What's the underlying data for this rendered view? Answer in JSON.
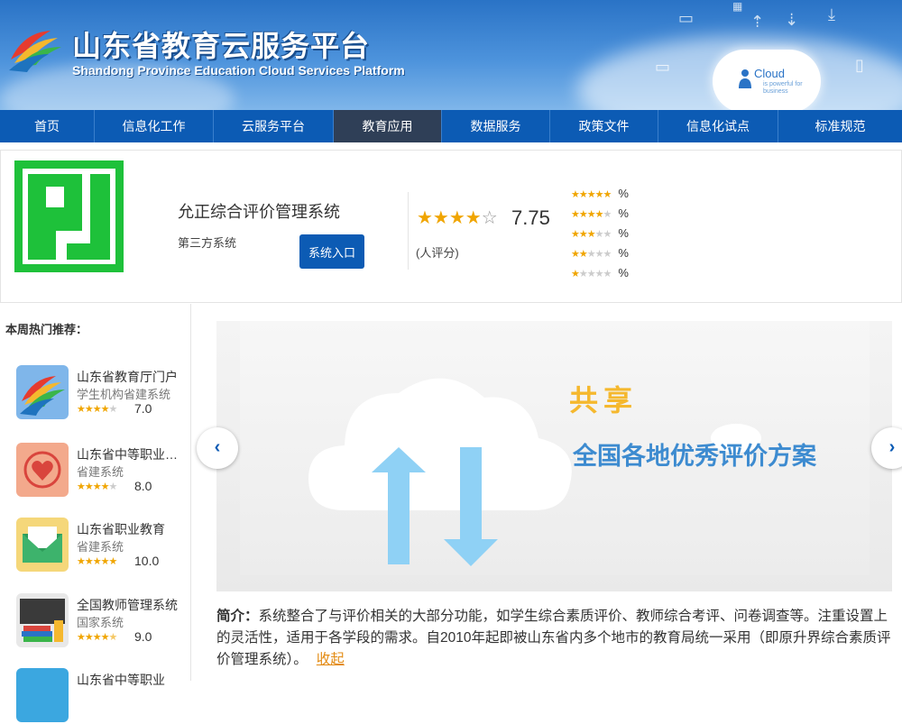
{
  "header": {
    "title_cn": "山东省教育云服务平台",
    "title_en": "Shandong Province Education Cloud Services Platform",
    "cloud_label": "Cloud",
    "cloud_tagline": "is powerful for business"
  },
  "nav": {
    "items": [
      {
        "label": "首页",
        "width": 0
      },
      {
        "label": "信息化工作"
      },
      {
        "label": "云服务平台"
      },
      {
        "label": "教育应用"
      },
      {
        "label": "数据服务"
      },
      {
        "label": "政策文件"
      },
      {
        "label": "信息化试点"
      },
      {
        "label": "标准规范"
      }
    ],
    "active": "教育应用"
  },
  "product": {
    "name": "允正综合评价管理系统",
    "type": "第三方系统",
    "enter_button": "系统入口",
    "rating": 3.5,
    "score": "7.75",
    "rating_count": "(人评分)",
    "distribution": [
      {
        "stars": 5,
        "percent": "%"
      },
      {
        "stars": 4,
        "percent": "%"
      },
      {
        "stars": 3,
        "percent": "%"
      },
      {
        "stars": 2,
        "percent": "%"
      },
      {
        "stars": 1,
        "percent": "%"
      }
    ]
  },
  "sidebar": {
    "title": "本周热门推荐：",
    "items": [
      {
        "name": "山东省教育厅门户",
        "type": "学生机构省建系统",
        "stars": 3.5,
        "score": "7.0",
        "icon": "education-platform-logo"
      },
      {
        "name": "山东省中等职业学校",
        "type": "省建系统",
        "stars": 4,
        "score": "8.0",
        "icon": "heart-icon"
      },
      {
        "name": "山东省职业教育",
        "type": "省建系统",
        "stars": 5,
        "score": "10.0",
        "icon": "envelope-icon"
      },
      {
        "name": "全国教师管理系统",
        "type": "国家系统",
        "stars": 4.5,
        "score": "9.0",
        "icon": "books-icon"
      },
      {
        "name": "山东省中等职业",
        "type": "",
        "stars": 0,
        "score": "",
        "icon": "app-icon"
      }
    ]
  },
  "banner": {
    "headline": "共享",
    "subline": "全国各地优秀评价方案"
  },
  "intro": {
    "label": "简介：",
    "text": "系统整合了与评价相关的大部分功能，如学生综合素质评价、教师综合考评、问卷调查等。注重设置上的灵活性，适用于各学段的需求。自2010年起即被山东省内多个地市的教育局统一采用（即原升界综合素质评价管理系统）。",
    "collapse_label": "收起"
  },
  "colors": {
    "nav_bg": "#0c5bb4",
    "nav_active": "#2f3f57",
    "star": "#f0a500",
    "accent_orange": "#e38b13"
  }
}
